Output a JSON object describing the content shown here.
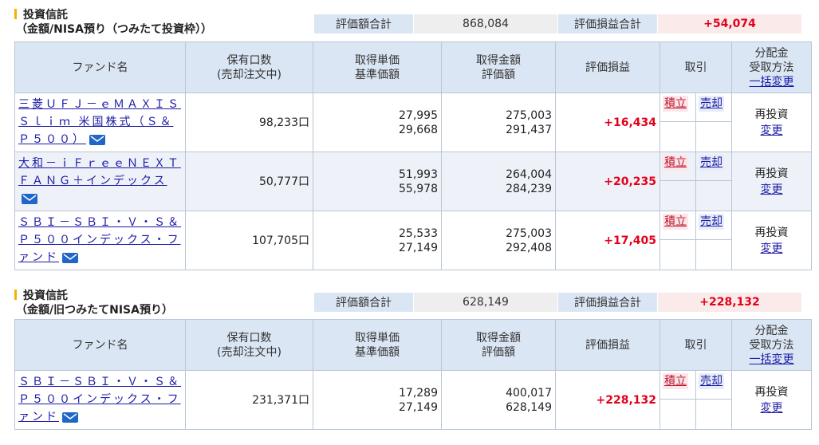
{
  "sections": [
    {
      "title_l1": "投資信託",
      "title_l2": "（金額/NISA預り（つみたて投資枠））",
      "summary": {
        "eval_total_label": "評価額合計",
        "eval_total": "868,084",
        "pl_total_label": "評価損益合計",
        "pl_total": "+54,074"
      },
      "headers": {
        "fund": "ファンド名",
        "holding_l1": "保有口数",
        "holding_l2": "(売却注文中)",
        "unit_l1": "取得単価",
        "unit_l2": "基準価額",
        "amount_l1": "取得金額",
        "amount_l2": "評価額",
        "pl": "評価損益",
        "trade": "取引",
        "div_l1": "分配金",
        "div_l2": "受取方法",
        "div_link": "一括変更"
      },
      "rows": [
        {
          "name": "三菱ＵＦＪ－ｅＭＡＸＩＳ Ｓｌｉｍ 米国株式（Ｓ＆Ｐ５００）",
          "units": "98,233口",
          "cost_unit": "27,995",
          "nav": "29,668",
          "cost": "275,003",
          "value": "291,437",
          "pl": "+16,434",
          "buy": "積立",
          "sell": "売却",
          "div": "再投資",
          "div_change": "変更"
        },
        {
          "name": "大和－ｉＦｒｅｅＮＥＸＴ ＦＡＮＧ＋インデックス",
          "units": "50,777口",
          "cost_unit": "51,993",
          "nav": "55,978",
          "cost": "264,004",
          "value": "284,239",
          "pl": "+20,235",
          "buy": "積立",
          "sell": "売却",
          "div": "再投資",
          "div_change": "変更"
        },
        {
          "name": "ＳＢＩ－ＳＢＩ・Ｖ・Ｓ＆Ｐ５００インデックス・ファンド",
          "units": "107,705口",
          "cost_unit": "25,533",
          "nav": "27,149",
          "cost": "275,003",
          "value": "292,408",
          "pl": "+17,405",
          "buy": "積立",
          "sell": "売却",
          "div": "再投資",
          "div_change": "変更"
        }
      ]
    },
    {
      "title_l1": "投資信託",
      "title_l2": "（金額/旧つみたてNISA預り）",
      "summary": {
        "eval_total_label": "評価額合計",
        "eval_total": "628,149",
        "pl_total_label": "評価損益合計",
        "pl_total": "+228,132"
      },
      "headers": {
        "fund": "ファンド名",
        "holding_l1": "保有口数",
        "holding_l2": "(売却注文中)",
        "unit_l1": "取得単価",
        "unit_l2": "基準価額",
        "amount_l1": "取得金額",
        "amount_l2": "評価額",
        "pl": "評価損益",
        "trade": "取引",
        "div_l1": "分配金",
        "div_l2": "受取方法",
        "div_link": "一括変更"
      },
      "rows": [
        {
          "name": "ＳＢＩ－ＳＢＩ・Ｖ・Ｓ＆Ｐ５００インデックス・ファンド",
          "units": "231,371口",
          "cost_unit": "17,289",
          "nav": "27,149",
          "cost": "400,017",
          "value": "628,149",
          "pl": "+228,132",
          "buy": "積立",
          "sell": "売却",
          "div": "再投資",
          "div_change": "変更"
        }
      ]
    }
  ],
  "colors": {
    "header_bg": "#dbe6f4",
    "positive": "#e2001a",
    "link": "#1a1aa6",
    "accent_bar": "#f0b400"
  },
  "icons": {
    "mail": "mail-icon"
  }
}
